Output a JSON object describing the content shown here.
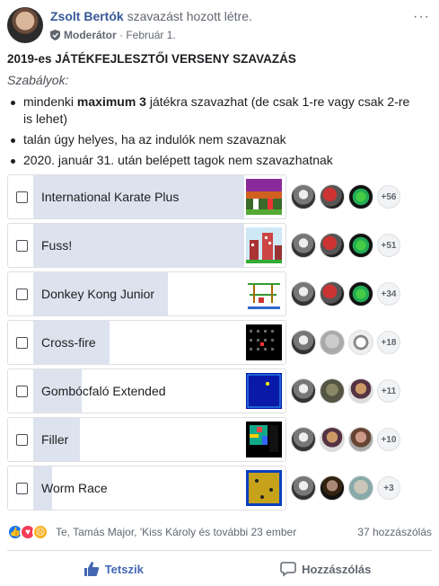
{
  "post": {
    "author": "Zsolt Bertók",
    "action": "szavazást hozott létre.",
    "role": "Moderátor",
    "date": "Február 1.",
    "more": "···",
    "title": "2019-es JÁTÉKFEJLESZTŐI VERSENY SZAVAZÁS",
    "rules_label": "Szabályok:",
    "rules": [
      {
        "pre": "mindenki ",
        "bold": "maximum 3",
        "post": " játékra szavazhat (de csak 1-re vagy csak 2-re is lehet)"
      },
      {
        "text": "talán úgy helyes, ha az indulók nem szavaznak"
      },
      {
        "text": "2020. január 31. után belépett tagok nem szavazhatnak"
      }
    ]
  },
  "poll": {
    "options": [
      {
        "label": "International Karate Plus",
        "fill": 1.0,
        "more": "+56",
        "avatars": [
          "a",
          "b",
          "c"
        ],
        "thumb": "karate"
      },
      {
        "label": "Fuss!",
        "fill": 1.0,
        "more": "+51",
        "avatars": [
          "a",
          "b",
          "c"
        ],
        "thumb": "fuss"
      },
      {
        "label": "Donkey Kong Junior",
        "fill": 0.64,
        "more": "+34",
        "avatars": [
          "a",
          "b",
          "c"
        ],
        "thumb": "dkjr"
      },
      {
        "label": "Cross-fire",
        "fill": 0.36,
        "more": "+18",
        "avatars": [
          "a",
          "d",
          "e"
        ],
        "thumb": "crossfire"
      },
      {
        "label": "Gombócfaló Extended",
        "fill": 0.23,
        "more": "+11",
        "avatars": [
          "a",
          "f",
          "g"
        ],
        "thumb": "gombocfalo"
      },
      {
        "label": "Filler",
        "fill": 0.22,
        "more": "+10",
        "avatars": [
          "a",
          "g",
          "h"
        ],
        "thumb": "filler"
      },
      {
        "label": "Worm Race",
        "fill": 0.09,
        "more": "+3",
        "avatars": [
          "a",
          "i",
          "j"
        ],
        "thumb": "wormrace"
      }
    ]
  },
  "footer": {
    "reactions_text": "Te, Tamás Major, 'Kiss Károly és további 23 ember",
    "comments_text": "37 hozzászólás",
    "like_label": "Tetszik",
    "comment_label": "Hozzászólás"
  },
  "colors": {
    "author": "#365899",
    "poll_fill": "#dde3ee",
    "like_blue": "#4267b2"
  }
}
